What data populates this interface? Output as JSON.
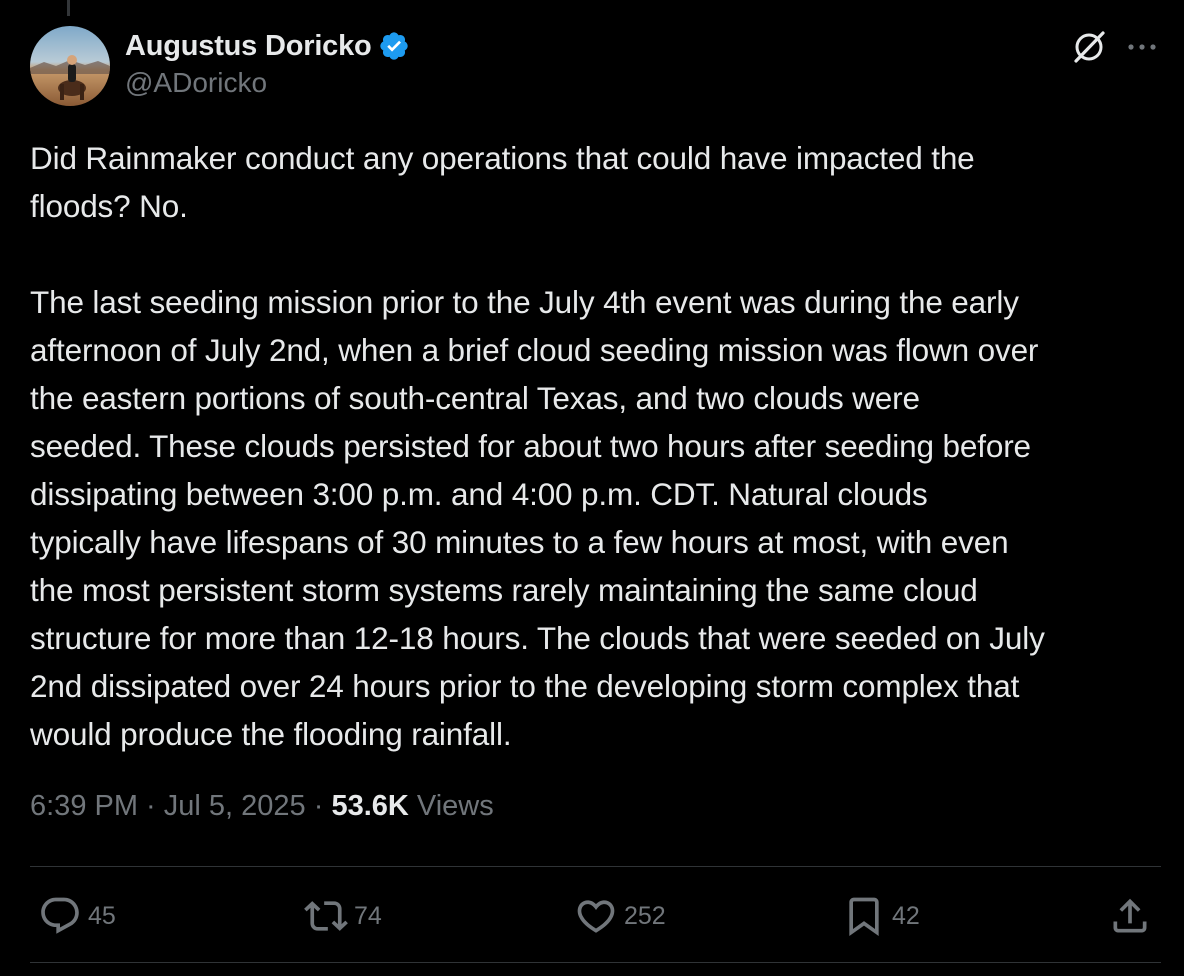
{
  "author": {
    "display_name": "Augustus Doricko",
    "handle": "@ADoricko",
    "verified": true
  },
  "tweet": {
    "text": "Did Rainmaker conduct any operations that could have impacted the\nfloods? No.\n\nThe last seeding mission prior to the July 4th event was during the early\nafternoon of July 2nd, when a brief cloud seeding mission was flown over\nthe eastern portions of south-central Texas, and two clouds were\nseeded. These clouds persisted for about two hours after seeding before\ndissipating between 3:00 p.m. and 4:00 p.m. CDT. Natural clouds\ntypically have lifespans of 30 minutes to a few hours at most, with even\nthe most persistent storm systems rarely maintaining the same cloud\nstructure for more than 12-18 hours. The clouds that were seeded on July\n2nd dissipated over 24 hours prior to the developing storm complex that\nwould produce the flooding rainfall.",
    "time": "6:39 PM",
    "separator": " · ",
    "date": "Jul 5, 2025",
    "views_count": "53.6K",
    "views_label": " Views"
  },
  "actions": {
    "replies": "45",
    "reposts": "74",
    "likes": "252",
    "bookmarks": "42"
  },
  "colors": {
    "background": "#000000",
    "text_primary": "#e7e9ea",
    "text_secondary": "#71767b",
    "verified_blue": "#1d9bf0",
    "divider": "#2f3336"
  },
  "icons": {
    "verified": "verified-badge-icon",
    "grok": "grok-icon",
    "more": "more-dots-icon",
    "reply": "reply-bubble-icon",
    "repost": "repost-arrows-icon",
    "like": "heart-icon",
    "bookmark": "bookmark-icon",
    "share": "share-upload-icon"
  }
}
